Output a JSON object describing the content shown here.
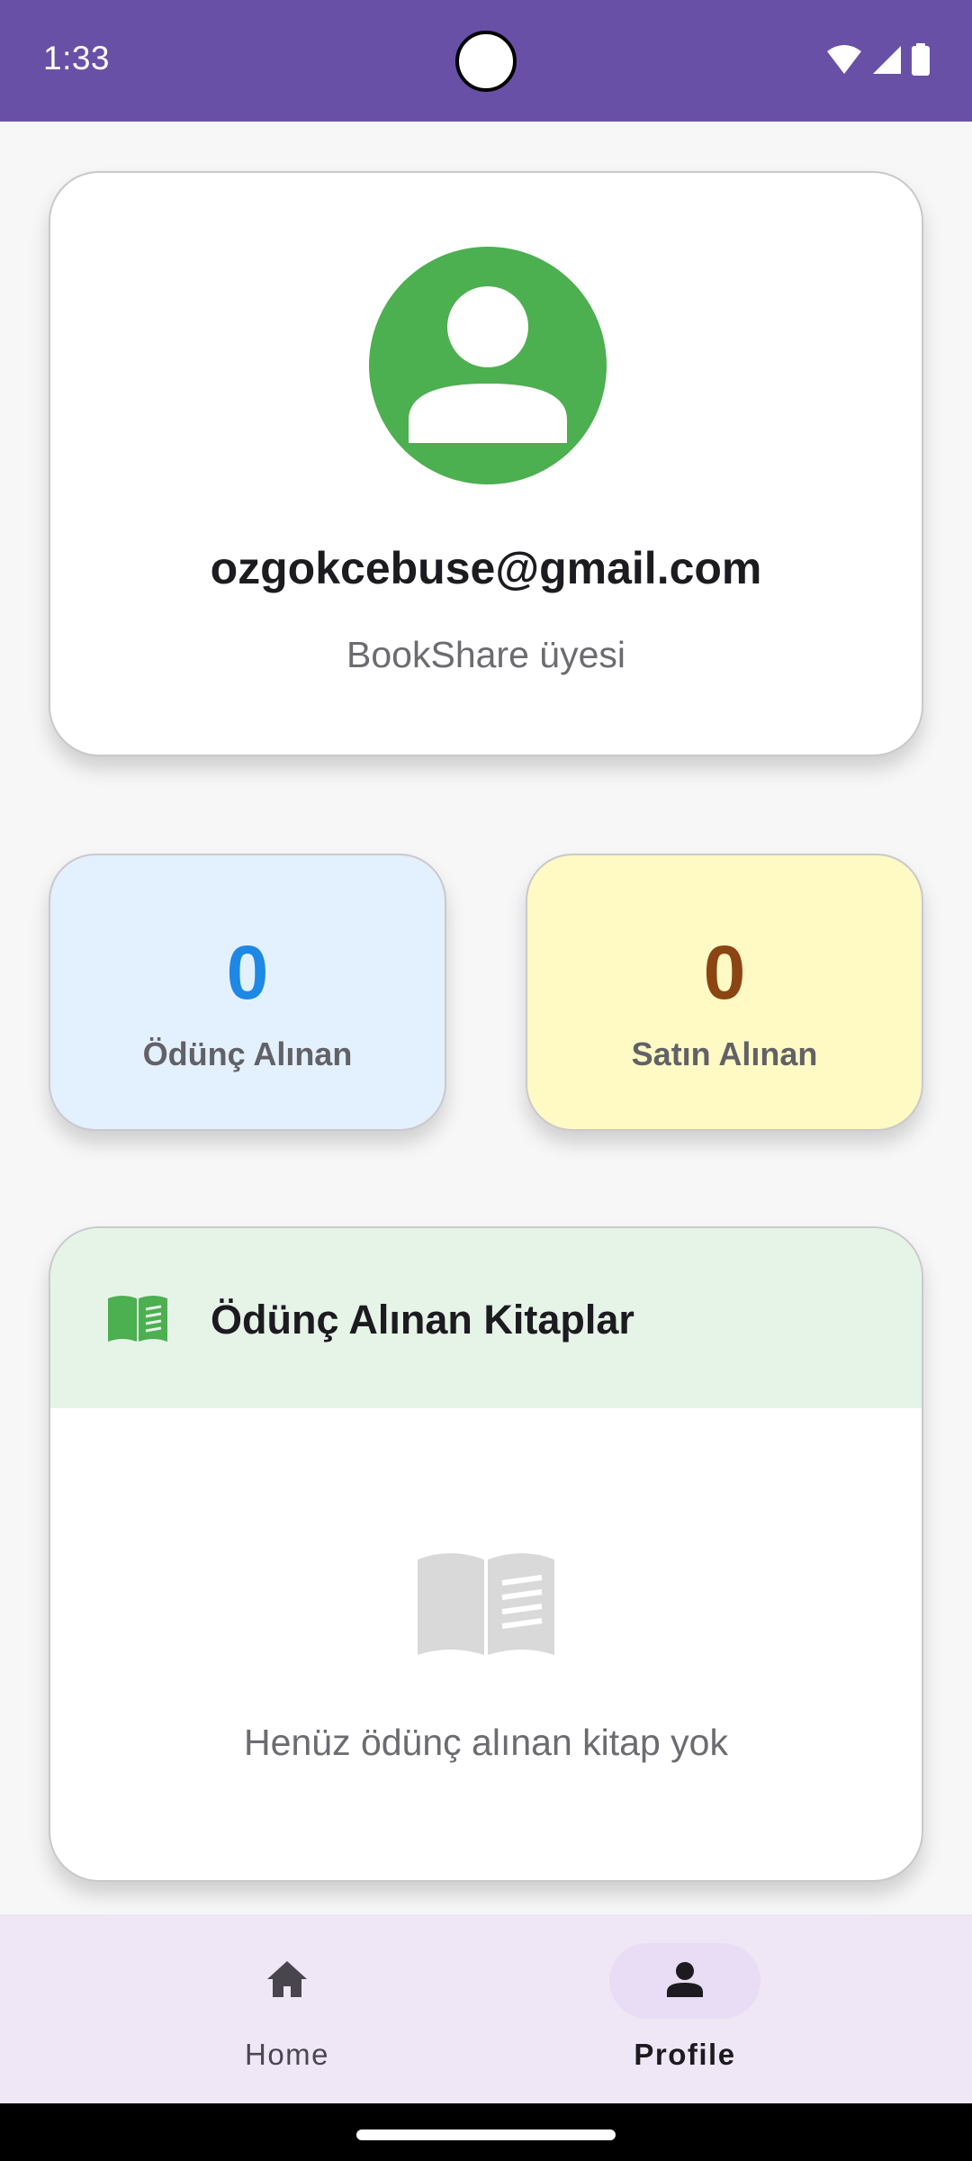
{
  "status_bar": {
    "time": "1:33",
    "icons": [
      "wifi-icon",
      "cellular-signal-icon",
      "battery-icon"
    ],
    "background": "#6850a6"
  },
  "profile": {
    "email": "ozgokcebuse@gmail.com",
    "subtitle": "BookShare üyesi",
    "avatar_color": "#4caf50"
  },
  "stats": {
    "borrowed": {
      "value": "0",
      "label": "Ödünç Alınan",
      "color": "#1e88e5"
    },
    "bought": {
      "value": "0",
      "label": "Satın Alınan",
      "color": "#8b4513"
    }
  },
  "borrowed_books": {
    "title": "Ödünç Alınan Kitaplar",
    "icon": "menu-book-icon",
    "empty_text": "Henüz ödünç alınan kitap yok"
  },
  "bottom_nav": {
    "items": [
      {
        "label": "Home",
        "icon": "home-icon",
        "selected": false
      },
      {
        "label": "Profile",
        "icon": "person-icon",
        "selected": true
      }
    ]
  }
}
